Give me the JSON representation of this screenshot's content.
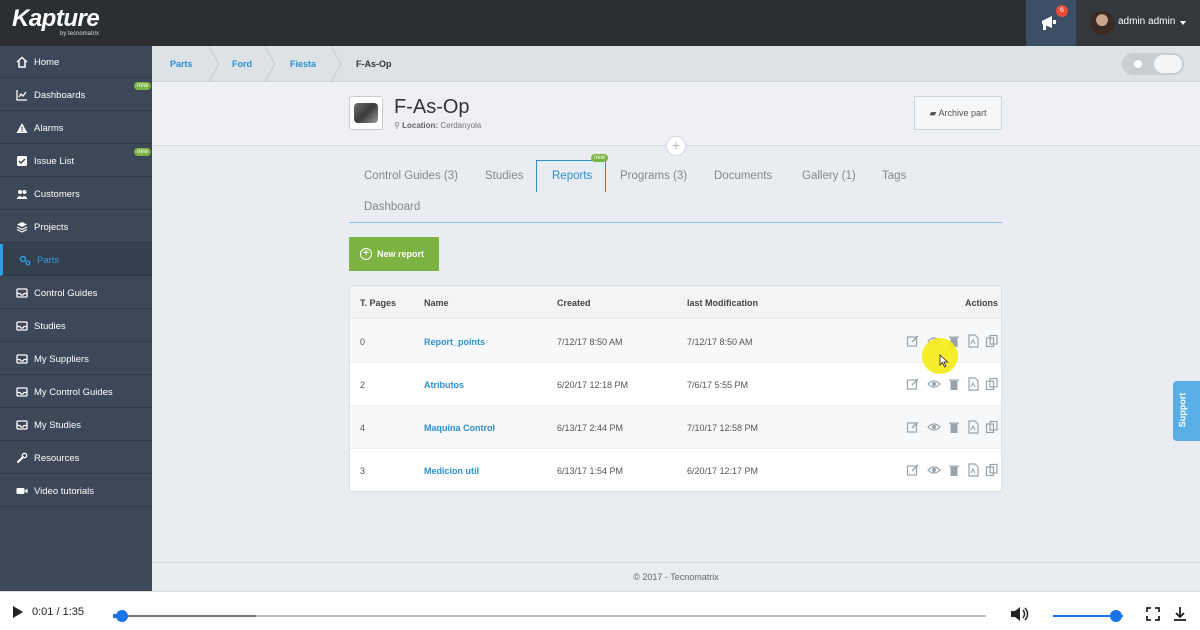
{
  "app": {
    "logo_main": "Kapture",
    "logo_sub": "by tecnomatrix",
    "notification_count": "6",
    "user_name": "admin admin"
  },
  "sidebar": {
    "items": [
      {
        "label": "Home",
        "icon": "home-icon"
      },
      {
        "label": "Dashboards",
        "icon": "line-chart-icon",
        "badge": "new"
      },
      {
        "label": "Alarms",
        "icon": "warning-icon"
      },
      {
        "label": "Issue List",
        "icon": "checkbox-icon",
        "badge": "new"
      },
      {
        "label": "Customers",
        "icon": "users-icon"
      },
      {
        "label": "Projects",
        "icon": "layers-icon"
      },
      {
        "label": "Parts",
        "icon": "gears-icon",
        "active": true
      },
      {
        "label": "Control Guides",
        "icon": "inbox-icon"
      },
      {
        "label": "Studies",
        "icon": "inbox-icon"
      },
      {
        "label": "My Suppliers",
        "icon": "inbox-icon"
      },
      {
        "label": "My Control Guides",
        "icon": "inbox-icon"
      },
      {
        "label": "My Studies",
        "icon": "inbox-icon"
      },
      {
        "label": "Resources",
        "icon": "wrench-icon"
      },
      {
        "label": "Video tutorials",
        "icon": "video-camera-icon"
      }
    ]
  },
  "breadcrumb": [
    "Parts",
    "Ford",
    "Fiesta",
    "F-As-Op"
  ],
  "part": {
    "title": "F-As-Op",
    "location_label": "Location:",
    "location_value": "Cerdanyola",
    "archive_label": "Archive part"
  },
  "tabs": [
    {
      "label": "Control Guides (3)"
    },
    {
      "label": "Studies"
    },
    {
      "label": "Reports",
      "active": true,
      "badge": "new"
    },
    {
      "label": "Programs (3)"
    },
    {
      "label": "Documents"
    },
    {
      "label": "Gallery (1)"
    },
    {
      "label": "Tags"
    },
    {
      "label": "Dashboard"
    }
  ],
  "new_report_label": "New report",
  "table": {
    "columns": [
      "T. Pages",
      "Name",
      "Created",
      "last Modification",
      "Actions"
    ],
    "rows": [
      {
        "pages": "0",
        "name": "Report_points",
        "created": "7/12/17 8:50 AM",
        "modified": "7/12/17 8:50 AM"
      },
      {
        "pages": "2",
        "name": "Atributos",
        "created": "6/20/17 12:18 PM",
        "modified": "7/6/17 5:55 PM"
      },
      {
        "pages": "4",
        "name": "Maquina Control",
        "created": "6/13/17 2:44 PM",
        "modified": "7/10/17 12:58 PM"
      },
      {
        "pages": "3",
        "name": "Medicion util",
        "created": "6/13/17 1:54 PM",
        "modified": "6/20/17 12:17 PM"
      }
    ]
  },
  "footer": "© 2017 - Tecnomatrix",
  "support_label": "Support",
  "video": {
    "time": "0:01 / 1:35",
    "progress_fraction": 0.01,
    "volume_fraction": 0.9
  },
  "colors": {
    "accent": "#2e8fd0",
    "green": "#7cb342",
    "sidebar": "#3c4858",
    "topbar": "#2b2f33"
  }
}
